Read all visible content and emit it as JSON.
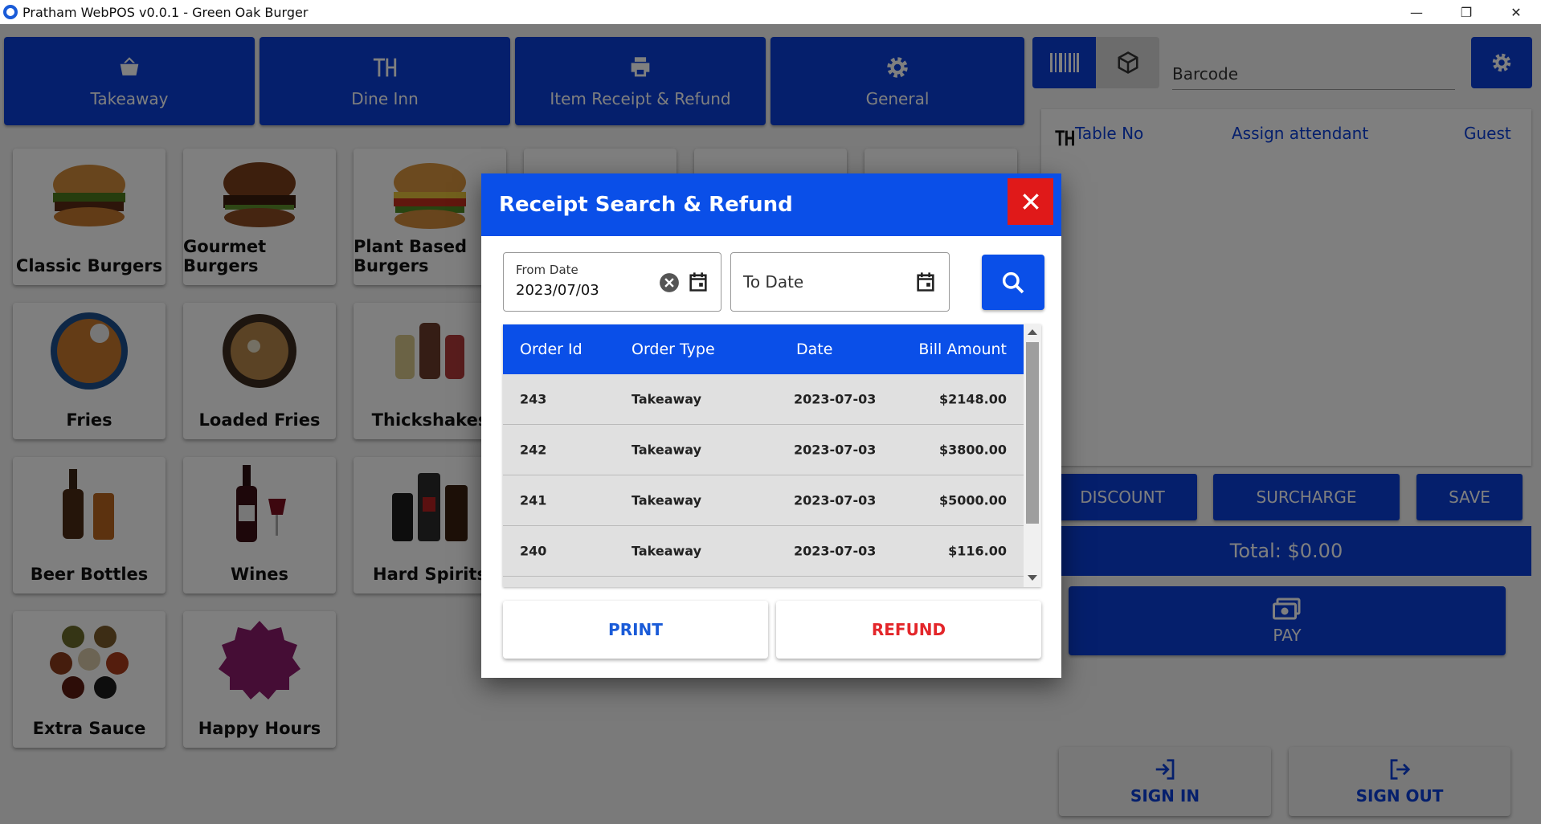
{
  "window": {
    "title": "Pratham WebPOS v0.0.1 - Green Oak Burger",
    "controls": [
      "—",
      "❐",
      "✕"
    ]
  },
  "topnav": [
    {
      "label": "Takeaway",
      "icon": "basket-icon"
    },
    {
      "label": "Dine Inn",
      "icon": "table-icon"
    },
    {
      "label": "Item Receipt & Refund",
      "icon": "printer-icon"
    },
    {
      "label": "General",
      "icon": "gear-icon"
    }
  ],
  "categories": [
    {
      "label": "Classic Burgers"
    },
    {
      "label": "Gourmet Burgers"
    },
    {
      "label": "Plant Based Burgers"
    },
    {
      "label": "Fries"
    },
    {
      "label": "Loaded Fries"
    },
    {
      "label": "Thickshakes"
    },
    {
      "label": "Beer Bottles"
    },
    {
      "label": "Wines"
    },
    {
      "label": "Hard Spirits"
    },
    {
      "label": "Extra Sauce"
    },
    {
      "label": "Happy Hours"
    }
  ],
  "barcode": {
    "placeholder": "Barcode"
  },
  "order_panel": {
    "table_no": "Table No",
    "attendant": "Assign attendant",
    "guest": "Guest"
  },
  "actions": {
    "discount": "DISCOUNT",
    "surcharge": "SURCHARGE",
    "save": "SAVE"
  },
  "total": "Total: $0.00",
  "pay": "PAY",
  "sign_in": "SIGN IN",
  "sign_out": "SIGN OUT",
  "dialog": {
    "title": "Receipt Search & Refund",
    "from_label": "From Date",
    "from_value": "2023/07/03",
    "to_placeholder": "To Date",
    "columns": [
      "Order Id",
      "Order Type",
      "Date",
      "Bill Amount"
    ],
    "rows": [
      {
        "id": "243",
        "type": "Takeaway",
        "date": "2023-07-03",
        "amount": "$2148.00"
      },
      {
        "id": "242",
        "type": "Takeaway",
        "date": "2023-07-03",
        "amount": "$3800.00"
      },
      {
        "id": "241",
        "type": "Takeaway",
        "date": "2023-07-03",
        "amount": "$5000.00"
      },
      {
        "id": "240",
        "type": "Takeaway",
        "date": "2023-07-03",
        "amount": "$116.00"
      }
    ],
    "print": "PRINT",
    "refund": "REFUND"
  },
  "colors": {
    "primary": "#0a3fd8",
    "dialog_header": "#0a4fe8",
    "close": "#e01919",
    "refund_text": "#e3262a",
    "print_text": "#1a5bd8"
  }
}
